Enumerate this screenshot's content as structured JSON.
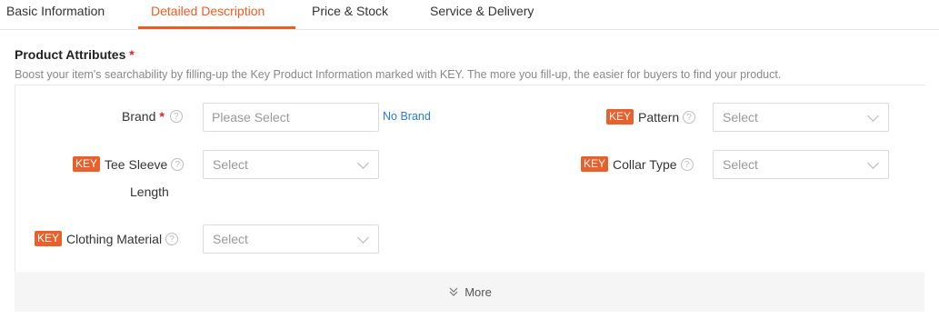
{
  "tabs": [
    {
      "label": "Basic Information",
      "active": false
    },
    {
      "label": "Detailed Description",
      "active": true
    },
    {
      "label": "Price & Stock",
      "active": false
    },
    {
      "label": "Service & Delivery",
      "active": false
    }
  ],
  "accent_color": "#f05d23",
  "section": {
    "title": "Product Attributes",
    "required_mark": "*",
    "hint": "Boost your item's searchability by filling-up the Key Product Information marked with KEY. The more you fill-up, the easier for buyers to find your product."
  },
  "key_badge": "KEY",
  "help_glyph": "?",
  "attributes": {
    "brand": {
      "label": "Brand",
      "placeholder": "Please Select",
      "no_brand_link": "No Brand"
    },
    "pattern": {
      "label": "Pattern",
      "value": "Select"
    },
    "tee_sleeve": {
      "label": "Tee Sleeve",
      "label_line2": "Length",
      "value": "Select"
    },
    "collar_type": {
      "label": "Collar Type",
      "value": "Select"
    },
    "clothing_material": {
      "label": "Clothing Material",
      "value": "Select"
    }
  },
  "more_button": "More",
  "bottom_text": ""
}
